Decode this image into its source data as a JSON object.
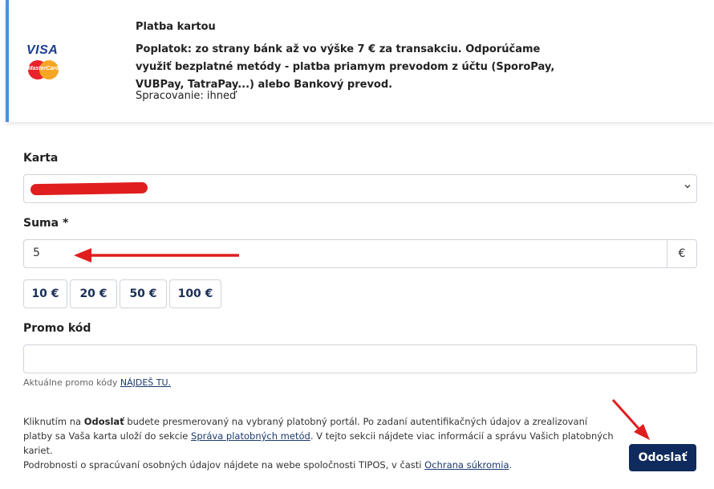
{
  "payment_method": {
    "title": "Platba kartou",
    "fee_text": "Poplatok: zo strany bánk až vo výške 7 € za transakciu. Odporúčame využiť bezplatné metódy - platba priamym prevodom z účtu (SporoPay, VUBPay, TatraPay...) alebo Bankový prevod.",
    "processing": "Spracovanie: ihneď",
    "logo_visa": "VISA",
    "logo_mastercard": "MasterCard",
    "accent_color": "#4a90e2"
  },
  "form": {
    "card_label": "Karta",
    "card_value": "",
    "amount_label": "Suma *",
    "amount_value": "5",
    "currency": "€",
    "quick_amounts": [
      "10 €",
      "20 €",
      "50 €",
      "100 €"
    ],
    "promo_label": "Promo kód",
    "promo_value": "",
    "promo_hint": "Aktuálne promo kódy",
    "promo_link": "NÁJDEŠ TU."
  },
  "info": {
    "p1_a": "Kliknutím na ",
    "p1_bold": "Odoslať",
    "p1_b": " budete presmerovaný na vybraný platobný portál. Po zadaní autentifikačných údajov a zrealizovaní platby sa Vaša karta uloží do sekcie ",
    "p1_link": "Správa platobných metód",
    "p1_c": ". V tejto sekcii nájdete viac informácií a správu Vašich platobných kariet.",
    "p2_a": "Podrobnosti o spracúvaní osobných údajov nájdete na webe spoločnosti TIPOS, v časti ",
    "p2_link": "Ochrana súkromia",
    "p2_b": "."
  },
  "submit_label": "Odoslať",
  "colors": {
    "primary": "#0f2a5c",
    "annotation_red": "#e01e1e"
  }
}
